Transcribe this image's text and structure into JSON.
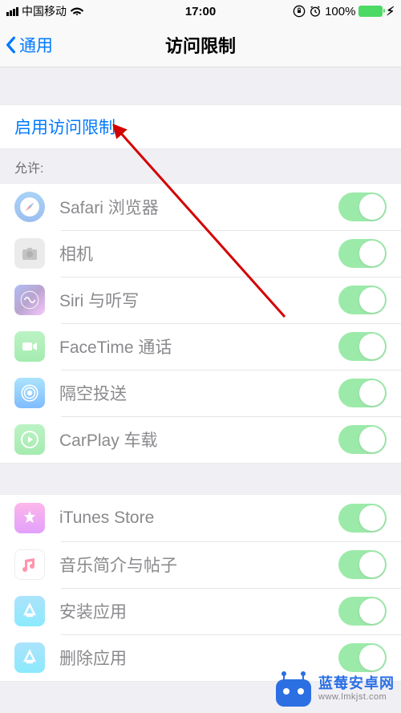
{
  "status": {
    "carrier": "中国移动",
    "time": "17:00",
    "battery_percent": "100%"
  },
  "nav": {
    "back_label": "通用",
    "title": "访问限制"
  },
  "enable_link": "启用访问限制",
  "section_allow_header": "允许:",
  "allow_items": [
    {
      "label": "Safari 浏览器",
      "icon": "safari"
    },
    {
      "label": "相机",
      "icon": "camera"
    },
    {
      "label": "Siri 与听写",
      "icon": "siri"
    },
    {
      "label": "FaceTime 通话",
      "icon": "facetime"
    },
    {
      "label": "隔空投送",
      "icon": "airdrop"
    },
    {
      "label": "CarPlay 车载",
      "icon": "carplay"
    }
  ],
  "store_items": [
    {
      "label": "iTunes Store",
      "icon": "itunes"
    },
    {
      "label": "音乐简介与帖子",
      "icon": "music"
    },
    {
      "label": "安装应用",
      "icon": "appstore"
    },
    {
      "label": "删除应用",
      "icon": "appstore"
    }
  ],
  "watermark": {
    "title": "蓝莓安卓网",
    "url": "www.lmkjst.com"
  }
}
